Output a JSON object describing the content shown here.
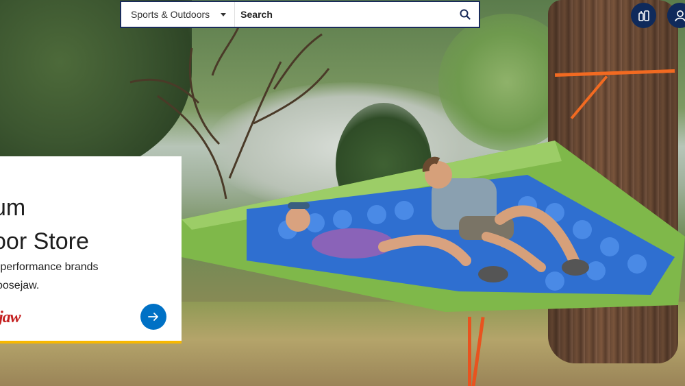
{
  "search": {
    "department": "Sports & Outdoors",
    "placeholder": "Search",
    "icon": "search-icon"
  },
  "header_buttons": [
    {
      "name": "lists-icon"
    },
    {
      "name": "account-icon"
    }
  ],
  "promo": {
    "title_line1": "um",
    "title_line2": "oor Store",
    "subtitle_line1": "-performance brands",
    "subtitle_line2": "oosejaw.",
    "brand_logo": "jaw",
    "arrow_icon": "arrow-right-icon"
  },
  "colors": {
    "navy": "#1a2c5b",
    "blue": "#0071c5",
    "accent_yellow": "#f7b800",
    "logo_red": "#c42020"
  }
}
